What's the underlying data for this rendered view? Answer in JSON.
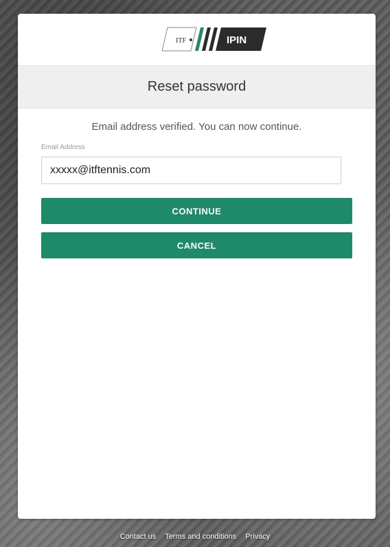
{
  "colors": {
    "primary_green": "#1f8a6a",
    "logo_dark": "#2b2b2b",
    "logo_green": "#1f8a6a"
  },
  "logo": {
    "itf_text": "ITF",
    "ipin_text": "IPIN"
  },
  "header": {
    "title": "Reset password"
  },
  "form": {
    "status_message": "Email address verified. You can now continue.",
    "email_label": "Email Address",
    "email_value": "xxxxx@itftennis.com"
  },
  "buttons": {
    "continue_label": "CONTINUE",
    "cancel_label": "CANCEL"
  },
  "footer": {
    "links": [
      "Contact us",
      "Terms and conditions",
      "Privacy"
    ]
  }
}
